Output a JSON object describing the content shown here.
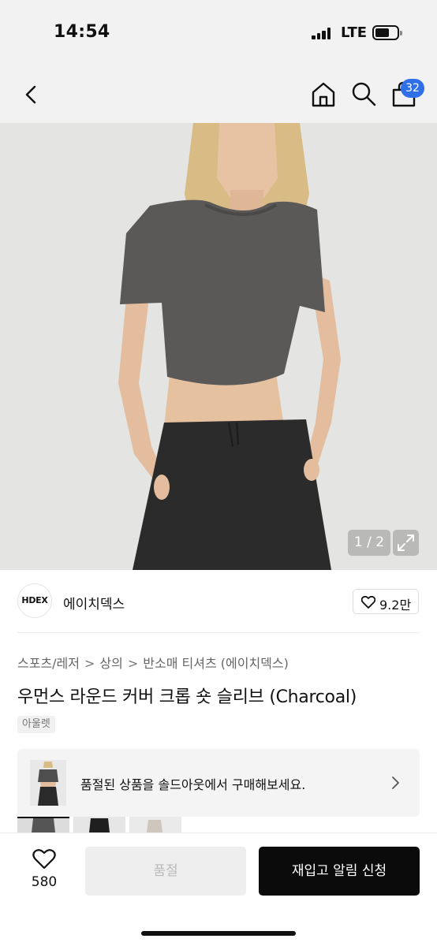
{
  "status_bar": {
    "time": "14:54",
    "network": "LTE",
    "signal_icon": "signal-bars-icon",
    "battery_icon": "battery-icon"
  },
  "nav": {
    "back_icon": "chevron-left-icon",
    "home_icon": "home-icon",
    "search_icon": "search-icon",
    "cart_icon": "shopping-bag-icon",
    "cart_count": "32",
    "accent_color": "#2f6fe8"
  },
  "hero": {
    "counter": "1 / 2",
    "expand_icon": "expand-icon"
  },
  "brand": {
    "logo_text": "HDEX",
    "name": "에이치덱스",
    "likes": "9.2만",
    "like_icon": "heart-icon"
  },
  "breadcrumb": {
    "items": [
      "스포츠/레저",
      "상의",
      "반소매 티셔츠 (에이치덱스)"
    ],
    "separator": ">"
  },
  "product": {
    "title": "우먼스 라운드 커버 크롭 숏 슬리브 (Charcoal)",
    "tag": "아울렛"
  },
  "soldout_banner": {
    "text": "품절된 상품을 솔드아웃에서 구매해보세요.",
    "arrow_icon": "chevron-right-icon"
  },
  "bottom_bar": {
    "wish_count": "580",
    "wish_icon": "heart-icon",
    "soldout_label": "품절",
    "restock_label": "재입고 알림 신청"
  }
}
